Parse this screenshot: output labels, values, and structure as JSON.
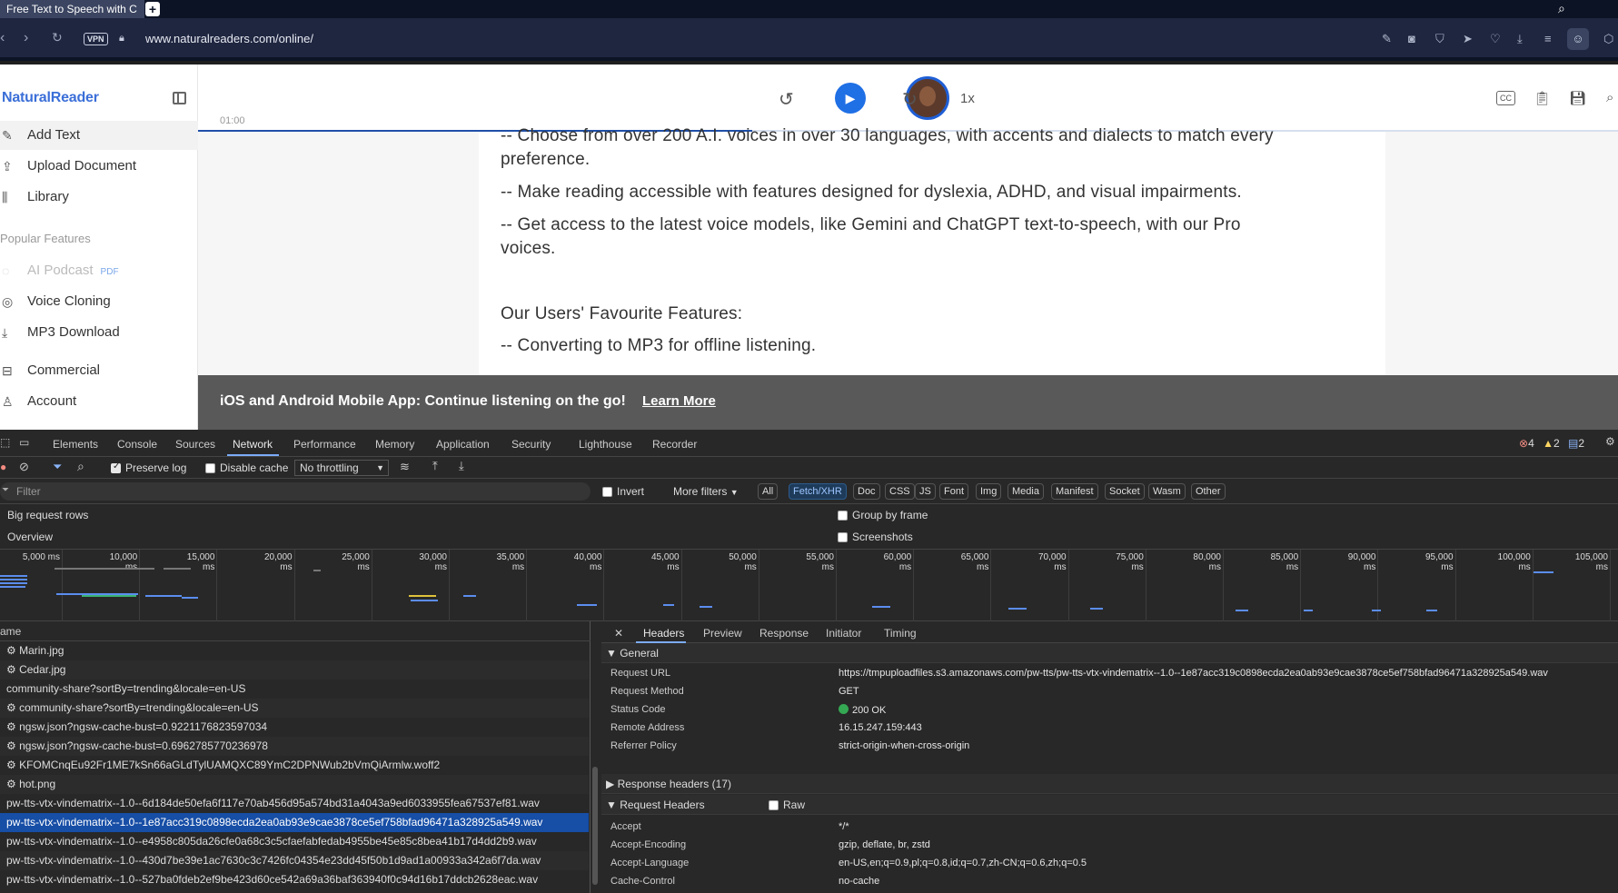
{
  "browser": {
    "tab_title": "Free Text to Speech with C",
    "new_tab": "+",
    "vpn_label": "VPN",
    "url": "www.naturalreaders.com/online/"
  },
  "sidebar": {
    "logo": "NaturalReader",
    "items": [
      {
        "label": "Add Text"
      },
      {
        "label": "Upload Document"
      },
      {
        "label": "Library"
      }
    ],
    "popular_label": "Popular Features",
    "features": [
      {
        "label": "AI Podcast",
        "tag": "PDF"
      },
      {
        "label": "Voice Cloning"
      },
      {
        "label": "MP3 Download"
      }
    ],
    "bottom": [
      {
        "label": "Commercial"
      },
      {
        "label": "Account"
      }
    ]
  },
  "player": {
    "time": "01:00",
    "speed": "1x",
    "cc": "CC",
    "progress_fraction": 0.39
  },
  "document": {
    "lines": [
      "-- Choose from over 200 A.I. voices in over 30 languages, with accents and dialects to match every",
      "preference.",
      "-- Make reading accessible with features designed for dyslexia, ADHD, and visual impairments.",
      "-- Get access to the latest voice models, like Gemini and ChatGPT text-to-speech, with our Pro",
      "voices.",
      "Our Users' Favourite Features:",
      "-- Converting to MP3 for offline listening."
    ]
  },
  "banner": {
    "text": "iOS and Android Mobile App: Continue listening on the go!",
    "link": "Learn More"
  },
  "devtools": {
    "tabs": [
      "Elements",
      "Console",
      "Sources",
      "Network",
      "Performance",
      "Memory",
      "Application",
      "Security",
      "Lighthouse",
      "Recorder"
    ],
    "active_tab": "Network",
    "errors": "4",
    "warnings": "2",
    "messages": "2",
    "toolbar": {
      "preserve_log": "Preserve log",
      "disable_cache": "Disable cache",
      "throttling": "No throttling"
    },
    "filter": {
      "placeholder": "Filter",
      "invert": "Invert",
      "more_filters": "More filters",
      "chips": [
        "All",
        "Fetch/XHR",
        "Doc",
        "CSS",
        "JS",
        "Font",
        "Img",
        "Media",
        "Manifest",
        "Socket",
        "Wasm",
        "Other"
      ]
    },
    "options": {
      "big_rows": "Big request rows",
      "overview": "Overview",
      "group_by_frame": "Group by frame",
      "screenshots": "Screenshots"
    },
    "timeline_labels": [
      "5,000 ms",
      "10,000 ms",
      "15,000 ms",
      "20,000 ms",
      "25,000 ms",
      "30,000 ms",
      "35,000 ms",
      "40,000 ms",
      "45,000 ms",
      "50,000 ms",
      "55,000 ms",
      "60,000 ms",
      "65,000 ms",
      "70,000 ms",
      "75,000 ms",
      "80,000 ms",
      "85,000 ms",
      "90,000 ms",
      "95,000 ms",
      "100,000 ms",
      "105,000 ms"
    ],
    "name_header": "ame",
    "requests": [
      "⚙ Marin.jpg",
      "⚙ Cedar.jpg",
      "community-share?sortBy=trending&locale=en-US",
      "⚙ community-share?sortBy=trending&locale=en-US",
      "⚙ ngsw.json?ngsw-cache-bust=0.9221176823597034",
      "⚙ ngsw.json?ngsw-cache-bust=0.6962785770236978",
      "⚙ KFOMCnqEu92Fr1ME7kSn66aGLdTylUAMQXC89YmC2DPNWub2bVmQiArmlw.woff2",
      "⚙ hot.png",
      "pw-tts-vtx-vindematrix--1.0--6d184de50efa6f117e70ab456d95a574bd31a4043a9ed6033955fea67537ef81.wav",
      "pw-tts-vtx-vindematrix--1.0--1e87acc319c0898ecda2ea0ab93e9cae3878ce5ef758bfad96471a328925a549.wav",
      "pw-tts-vtx-vindematrix--1.0--e4958c805da26cfe0a68c3c5cfaefabfedab4955be45e85c8bea41b17d4dd2b9.wav",
      "pw-tts-vtx-vindematrix--1.0--430d7be39e1ac7630c3c7426fc04354e23dd45f50b1d9ad1a00933a342a6f7da.wav",
      "pw-tts-vtx-vindematrix--1.0--527ba0fdeb2ef9be423d60ce542a69a36baf363940f0c94d16b17ddcb2628eac.wav"
    ],
    "detail_tabs": [
      "Headers",
      "Preview",
      "Response",
      "Initiator",
      "Timing"
    ],
    "general": {
      "title": "General",
      "rows": [
        {
          "k": "Request URL",
          "v": "https://tmpuploadfiles.s3.amazonaws.com/pw-tts/pw-tts-vtx-vindematrix--1.0--1e87acc319c0898ecda2ea0ab93e9cae3878ce5ef758bfad96471a328925a549.wav"
        },
        {
          "k": "Request Method",
          "v": "GET"
        },
        {
          "k": "Status Code",
          "v": "200 OK"
        },
        {
          "k": "Remote Address",
          "v": "16.15.247.159:443"
        },
        {
          "k": "Referrer Policy",
          "v": "strict-origin-when-cross-origin"
        }
      ]
    },
    "response_headers": "Response headers (17)",
    "request_headers": {
      "title": "Request Headers",
      "raw": "Raw",
      "rows": [
        {
          "k": "Accept",
          "v": "*/*"
        },
        {
          "k": "Accept-Encoding",
          "v": "gzip, deflate, br, zstd"
        },
        {
          "k": "Accept-Language",
          "v": "en-US,en;q=0.9,pl;q=0.8,id;q=0.7,zh-CN;q=0.6,zh;q=0.5"
        },
        {
          "k": "Cache-Control",
          "v": "no-cache"
        }
      ]
    }
  }
}
